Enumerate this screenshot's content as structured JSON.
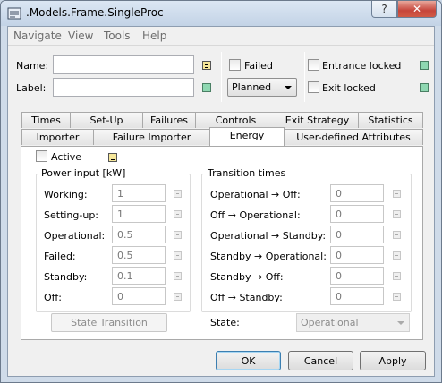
{
  "window": {
    "title": ".Models.Frame.SingleProc",
    "help_glyph": "?",
    "close_glyph": "✕"
  },
  "menu": [
    "Navigate",
    "View",
    "Tools",
    "Help"
  ],
  "header": {
    "name_label": "Name:",
    "name_value": "",
    "label_label": "Label:",
    "label_value": "",
    "failed_label": "Failed",
    "planned_value": "Planned",
    "entrance_locked_label": "Entrance locked",
    "exit_locked_label": "Exit locked"
  },
  "tabs_row1": [
    "Times",
    "Set-Up",
    "Failures",
    "Controls",
    "Exit Strategy",
    "Statistics"
  ],
  "tabs_row2": [
    "Importer",
    "Failure Importer",
    "Energy",
    "User-defined Attributes"
  ],
  "energy": {
    "active_label": "Active",
    "power_group_title": "Power input [kW]",
    "power_rows": [
      {
        "label": "Working:",
        "value": "1"
      },
      {
        "label": "Setting-up:",
        "value": "1"
      },
      {
        "label": "Operational:",
        "value": "0.5"
      },
      {
        "label": "Failed:",
        "value": "0.5"
      },
      {
        "label": "Standby:",
        "value": "0.1"
      },
      {
        "label": "Off:",
        "value": "0"
      }
    ],
    "transition_group_title": "Transition times",
    "transition_rows": [
      {
        "label": "Operational → Off:",
        "value": "0"
      },
      {
        "label": "Off → Operational:",
        "value": "0"
      },
      {
        "label": "Operational → Standby:",
        "value": "0"
      },
      {
        "label": "Standby → Operational:",
        "value": "0"
      },
      {
        "label": "Standby → Off:",
        "value": "0"
      },
      {
        "label": "Off → Standby:",
        "value": "0"
      }
    ],
    "state_transition_button": "State Transition",
    "state_label": "State:",
    "state_value": "Operational"
  },
  "buttons": {
    "ok": "OK",
    "cancel": "Cancel",
    "apply": "Apply"
  },
  "colors": {
    "indicator_yellow": "#f6e79a",
    "indicator_green": "#8fd8b2",
    "close_red": "#c6453a"
  }
}
